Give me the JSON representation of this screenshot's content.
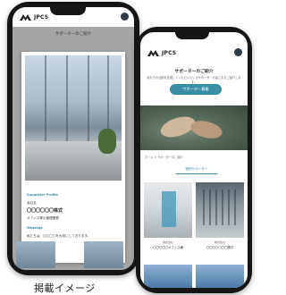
{
  "caption": "掲載イメージ",
  "app": {
    "brand": "JPCS"
  },
  "screen_a": {
    "page_title": "サポーターのご紹介",
    "page_subtitle": "",
    "modal": {
      "label_profile": "Supporter Profile",
      "company_label": "会社名",
      "company_name": "〇〇〇〇〇〇株式",
      "department": "オフィス等の管理業務",
      "label_message": "Message",
      "message": "私たちは、〇〇〇〇を大切にしております。"
    }
  },
  "screen_b": {
    "page_title": "サポーターのご紹介",
    "page_subtitle": "私たちの活動を支援していただいているサポーターの皆さまをご紹介します。",
    "cta_button": "サポーター募集",
    "breadcrumb": "ホーム > サポーターのご紹介",
    "tab_label": "個別サポーター",
    "cards": [
      {
        "caption": "株式会社",
        "name": "〇〇〇〇〇オフィス様"
      },
      {
        "caption": "株式会社",
        "name": "〇〇〇〇〇〇〇株式"
      }
    ]
  },
  "colors": {
    "accent": "#3a8da4",
    "phone_frame": "#161616"
  }
}
